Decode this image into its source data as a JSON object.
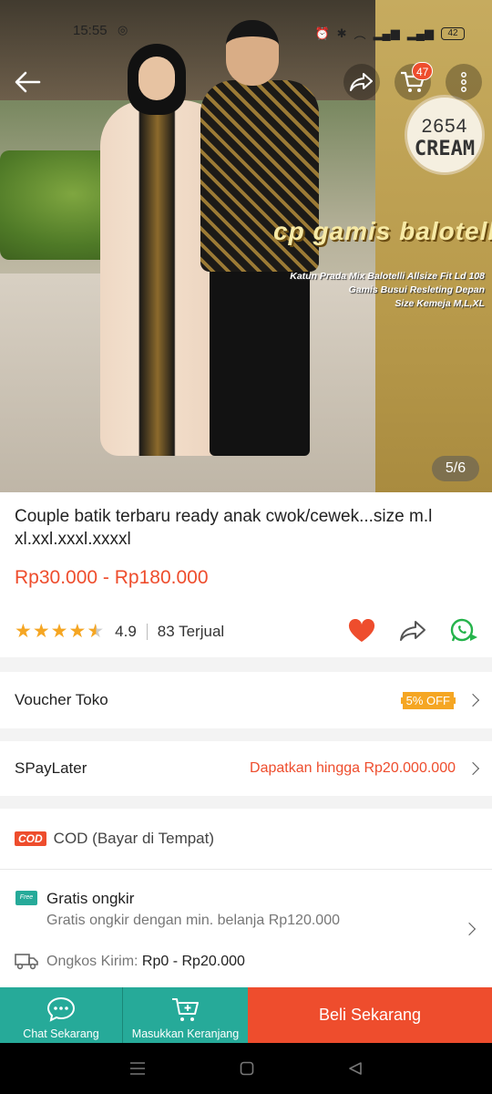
{
  "status_bar": {
    "time": "15:55",
    "battery": "42"
  },
  "header": {
    "cart_count": "47"
  },
  "image": {
    "badge_code": "2654",
    "badge_tone": "CREAM",
    "watermark": "cp gamis balotelli",
    "caption_lines": [
      "Katun Prada Mix Balotelli Allsize Fit Ld 108",
      "Gamis Busui Resleting Depan",
      "Size Kemeja M,L,XL"
    ],
    "page_indicator": "5/6"
  },
  "product": {
    "title": "Couple batik terbaru ready anak cwok/cewek...size m.l xl.xxl.xxxl.xxxxl",
    "price": "Rp30.000 - Rp180.000",
    "rating": "4.9",
    "rating_stars": 4.5,
    "sold": "83 Terjual"
  },
  "rows": {
    "voucher_label": "Voucher Toko",
    "voucher_tag": "5% OFF",
    "paylater_label": "SPayLater",
    "paylater_info": "Dapatkan hingga Rp20.000.000",
    "cod_badge": "COD",
    "cod_label": "COD (Bayar di Tempat)"
  },
  "shipping": {
    "free_icon_text": "Free",
    "title": "Gratis ongkir",
    "subtitle": "Gratis ongkir dengan min. belanja Rp120.000",
    "cost_label": "Ongkos Kirim:",
    "cost_value": "Rp0 - Rp20.000"
  },
  "bottom_bar": {
    "chat_label": "Chat Sekarang",
    "cart_label": "Masukkan Keranjang",
    "buy_label": "Beli Sekarang"
  },
  "colors": {
    "accent": "#ee4d2d",
    "teal": "#26aa99",
    "star": "#f5a623"
  }
}
